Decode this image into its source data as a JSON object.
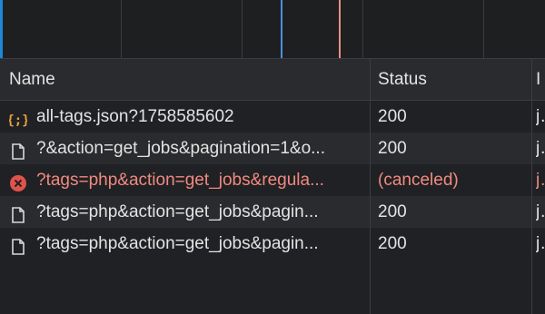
{
  "colors": {
    "background": "#202124",
    "row_alt": "#2a2b2e",
    "text": "#e3e3e3",
    "error_text": "#f08a80",
    "json_icon": "#e8a33c",
    "error_icon": "#e0534b",
    "timeline_blue": "#4a90e2",
    "timeline_red": "#e88f84"
  },
  "columns": {
    "name": "Name",
    "status": "Status",
    "type": "I"
  },
  "rows": [
    {
      "icon": "json-icon",
      "name": "all-tags.json?1758585602",
      "status": "200",
      "type": "jg",
      "error": false
    },
    {
      "icon": "document-icon",
      "name": "?&action=get_jobs&pagination=1&o...",
      "status": "200",
      "type": "jg",
      "error": false
    },
    {
      "icon": "error-icon",
      "name": "?tags=php&action=get_jobs&regula...",
      "status": "(canceled)",
      "type": "jg",
      "error": true
    },
    {
      "icon": "document-icon",
      "name": "?tags=php&action=get_jobs&pagin...",
      "status": "200",
      "type": "jg",
      "error": false
    },
    {
      "icon": "document-icon",
      "name": "?tags=php&action=get_jobs&pagin...",
      "status": "200",
      "type": "jg",
      "error": false
    }
  ]
}
